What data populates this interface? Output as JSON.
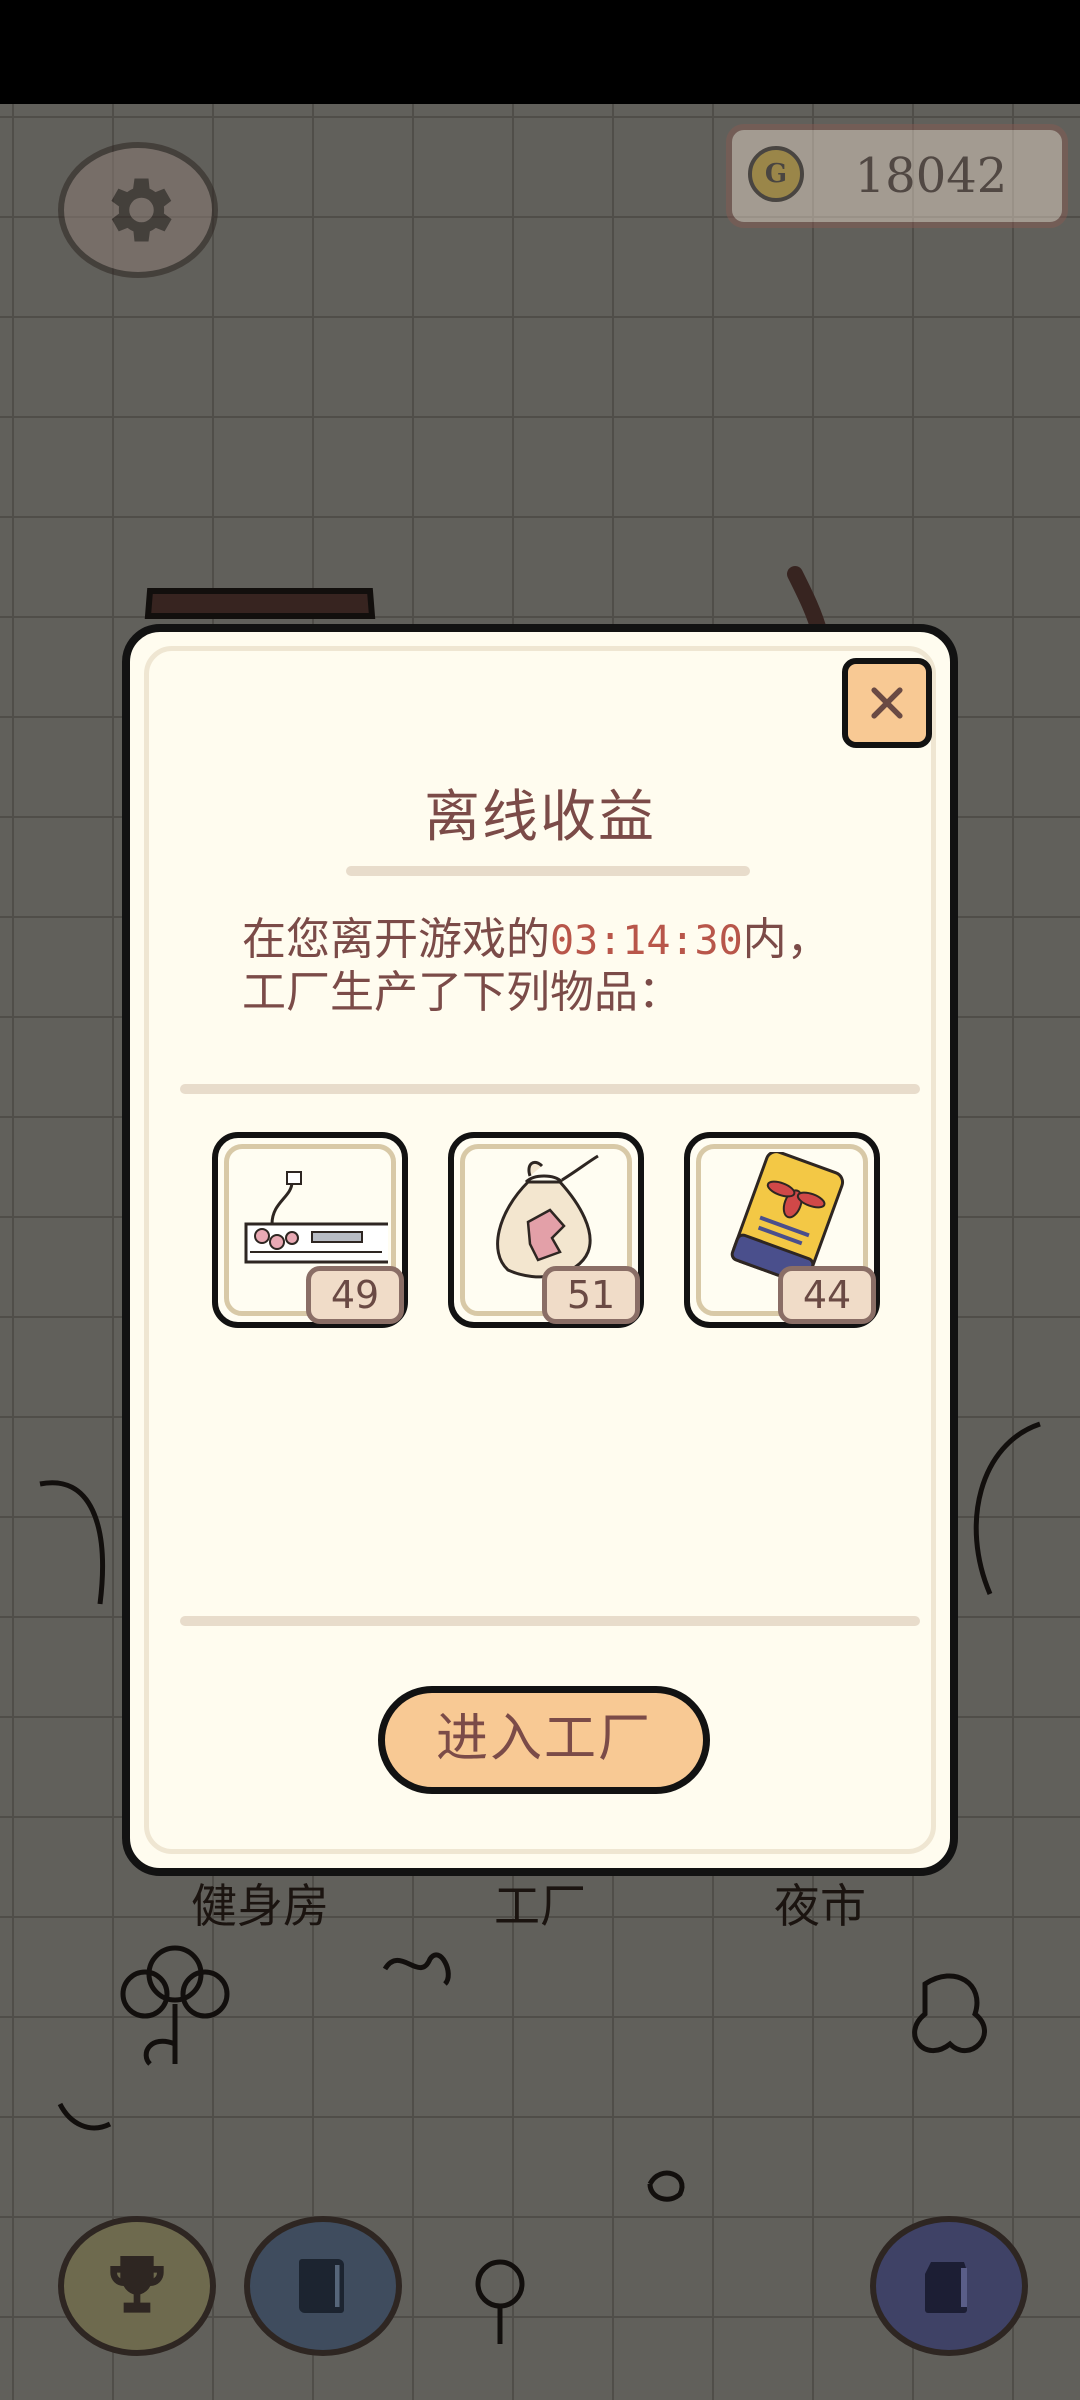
{
  "hud": {
    "coins": "18042",
    "coin_symbol": "G"
  },
  "buildings": [
    "健身房",
    "工厂",
    "夜市"
  ],
  "modal": {
    "title": "离线收益",
    "message_prefix": "在您离开游戏的",
    "offline_time": "03:14:30",
    "message_suffix": "内，",
    "message_line2": "工厂生产了下列物品：",
    "items": [
      {
        "icon": "air-conditioner-icon",
        "count": "49"
      },
      {
        "icon": "cloth-sack-icon",
        "count": "51"
      },
      {
        "icon": "drink-can-icon",
        "count": "44"
      }
    ],
    "button_label": "进入工厂"
  },
  "colors": {
    "accent": "#f8c994",
    "text": "#7b4b48",
    "time_highlight": "#b8564a",
    "panel_bg": "#fffcef"
  }
}
